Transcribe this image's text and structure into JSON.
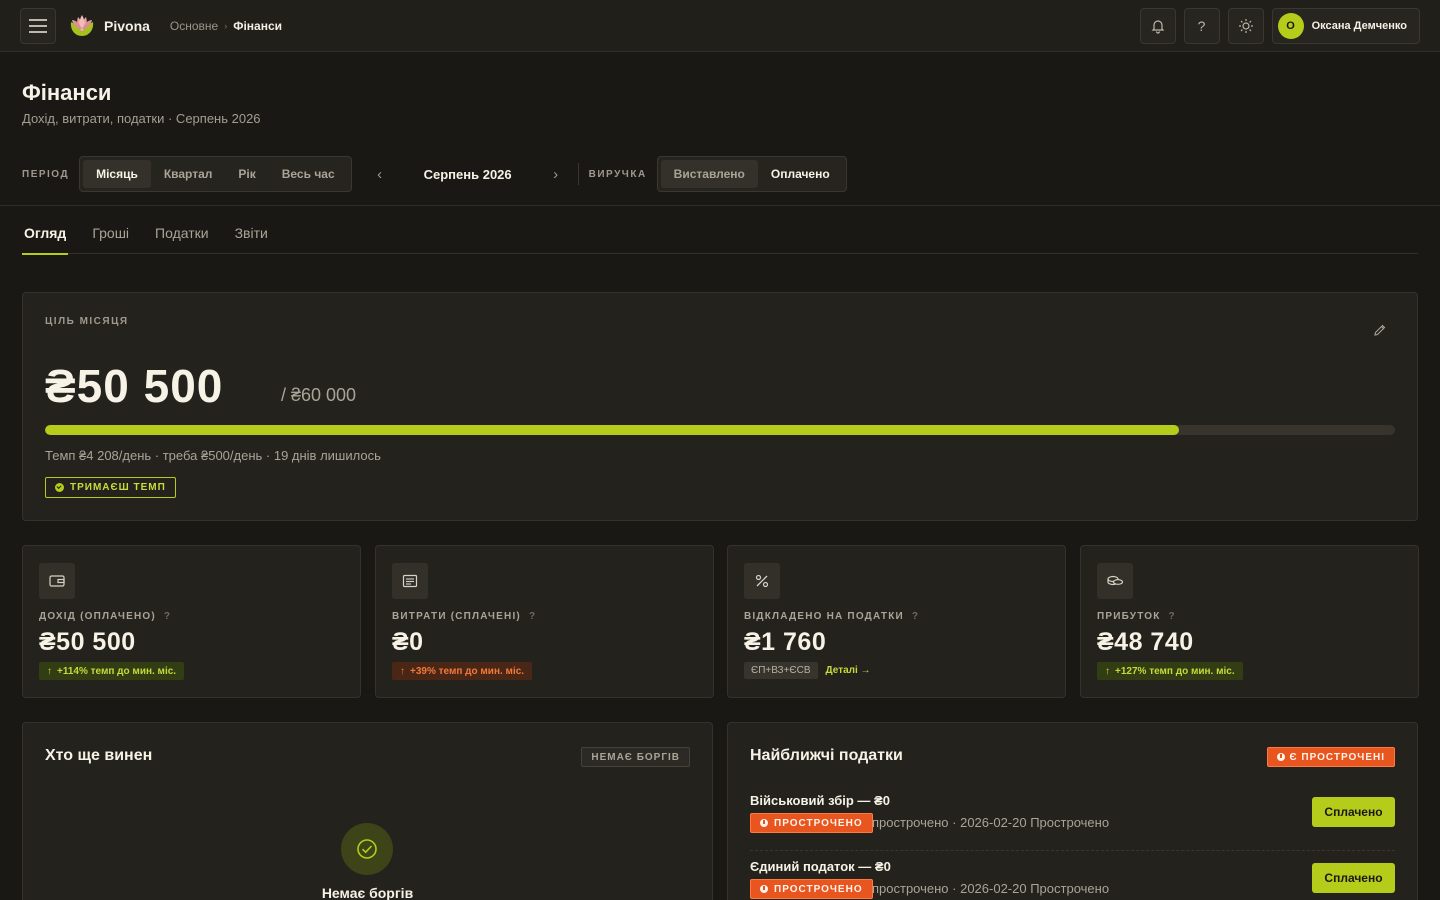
{
  "app": {
    "name": "Pivona",
    "breadcrumb": [
      "Основне",
      "Фінанси"
    ],
    "user": {
      "name": "Оксана Демченко",
      "initial": "О"
    },
    "icons": {
      "menu": "menu-icon",
      "bell": "bell-icon",
      "help": "help-icon",
      "theme": "sun-icon"
    },
    "help_glyph": "?"
  },
  "page": {
    "title": "Фінанси",
    "subtitle": "Дохід, витрати, податки · Серпень 2026"
  },
  "filters": {
    "period_label": "ПЕРІОД",
    "periods": [
      "Місяць",
      "Квартал",
      "Рік",
      "Весь час"
    ],
    "active_period": "Місяць",
    "month": "Серпень 2026",
    "revenue_label": "ВИРУЧКА",
    "revenue_modes": [
      "Виставлено",
      "Оплачено"
    ],
    "active_revenue": "Оплачено"
  },
  "tabs": [
    "Огляд",
    "Гроші",
    "Податки",
    "Звіти"
  ],
  "active_tab": "Огляд",
  "goal": {
    "label": "ЦІЛЬ МІСЯЦЯ",
    "value": "₴50 500",
    "target": "/ ₴60 000",
    "progress": 0.84,
    "pace": "Темп ₴4 208/день · треба ₴500/день · 19 днів лишилось",
    "badge": "ТРИМАЄШ ТЕМП"
  },
  "stats": [
    {
      "icon": "wallet-icon",
      "label": "ДОХІД (ОПЛАЧЕНО)",
      "help": "?",
      "value": "₴50 500",
      "delta": "+114% темп до мин. міс.",
      "tone": "good"
    },
    {
      "icon": "receipt-icon",
      "label": "ВИТРАТИ (СПЛАЧЕНІ)",
      "help": "?",
      "value": "₴0",
      "delta": "+39% темп до мин. міс.",
      "tone": "bad"
    },
    {
      "icon": "percent-icon",
      "label": "ВІДКЛАДЕНО НА ПОДАТКИ",
      "help": "?",
      "value": "₴1 760",
      "chip": "ЄП+ВЗ+ЄСВ",
      "link": "Деталі →"
    },
    {
      "icon": "coins-icon",
      "label": "ПРИБУТОК",
      "help": "?",
      "value": "₴48 740",
      "delta": "+127% темп до мин. міс.",
      "tone": "good"
    }
  ],
  "debts": {
    "title": "Хто ще винен",
    "badge": "НЕМАЄ БОРГІВ",
    "empty_text": "Немає боргів"
  },
  "taxes": {
    "title": "Найближчі податки",
    "badge": "Є ПРОСТРОЧЕНІ",
    "items": [
      {
        "name": "Військовий збір — ₴0",
        "status": "ПРОСТРОЧЕНО",
        "meta": "прострочено · 2026-02-20  Прострочено",
        "action": "Сплачено"
      },
      {
        "name": "Єдиний податок — ₴0",
        "status": "ПРОСТРОЧЕНО",
        "meta": "прострочено · 2026-02-20  Прострочено",
        "action": "Сплачено"
      }
    ]
  },
  "colors": {
    "accent": "#b5cc1a",
    "alert": "#e8551e",
    "background": "#1a1814",
    "card": "#24221d"
  }
}
